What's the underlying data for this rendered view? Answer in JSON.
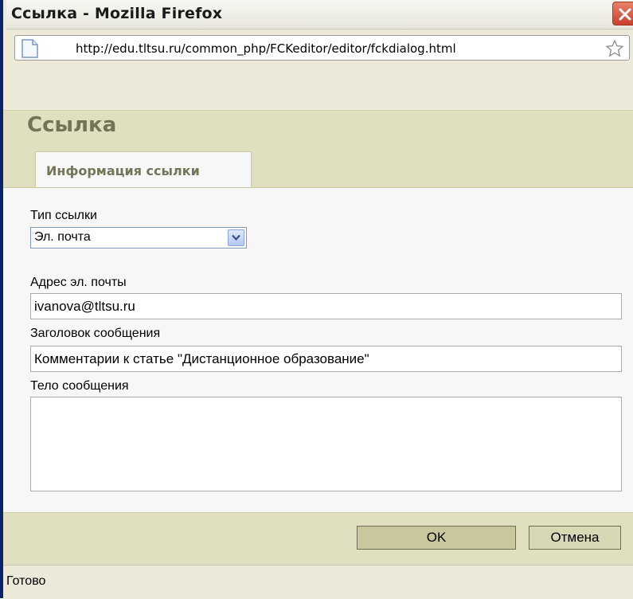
{
  "window": {
    "title": "Ссылка - Mozilla Firefox"
  },
  "urlbar": {
    "url": "http://edu.tltsu.ru/common_php/FCKeditor/editor/fckdialog.html"
  },
  "dialog": {
    "title": "Ссылка",
    "tab_label": "Информация ссылки",
    "link_type_label": "Тип ссылки",
    "link_type_value": "Эл. почта",
    "email_label": "Адрес эл. почты",
    "email_value": "ivanova@tltsu.ru",
    "subject_label": "Заголовок сообщения",
    "subject_value": "Комментарии к статье \"Дистанционное образование\"",
    "body_label": "Тело сообщения",
    "body_value": "",
    "ok_label": "OK",
    "cancel_label": "Отмена"
  },
  "status": {
    "text": "Готово"
  },
  "colors": {
    "dialog_band": "#e0dfbf",
    "title_olive": "#737357",
    "ok_button": "#c9c79b",
    "close_red": "#c8402a"
  },
  "icons": [
    "close-icon",
    "page-icon",
    "bookmark-star-icon",
    "chevron-down-icon"
  ]
}
